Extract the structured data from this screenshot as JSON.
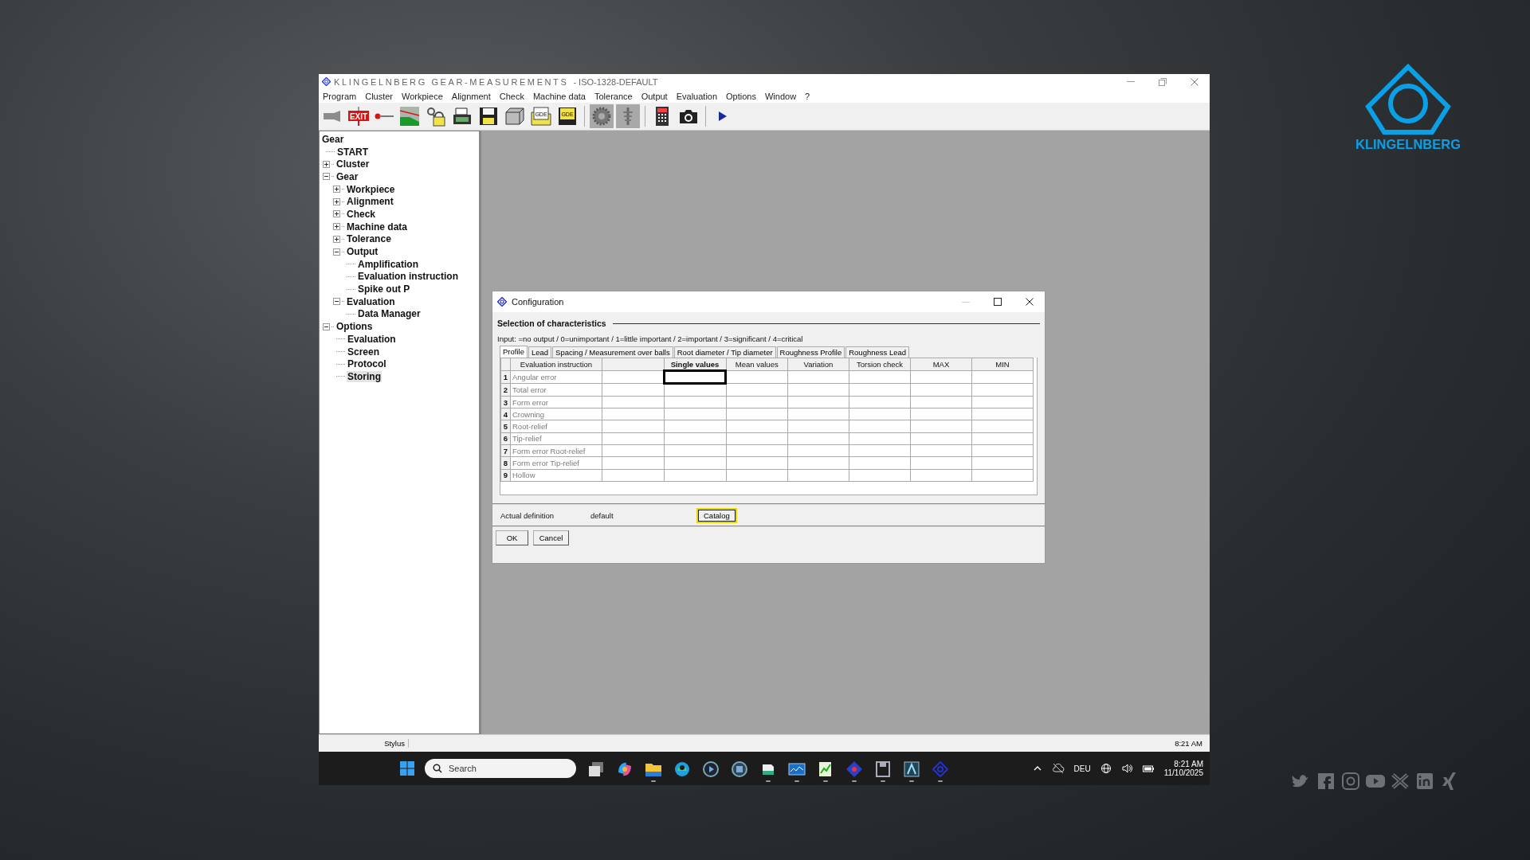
{
  "brand": {
    "logo_text": "KLINGELNBERG"
  },
  "social": [
    {
      "kind": "bird"
    },
    {
      "kind": "facebook"
    },
    {
      "kind": "instagram"
    },
    {
      "kind": "youtube"
    },
    {
      "kind": "cross"
    },
    {
      "kind": "linkedin"
    },
    {
      "kind": "xing"
    }
  ],
  "window": {
    "title_brand": "KLINGELNBERG GEAR-MEASUREMENTS",
    "title_suffix": "- ISO-1328-DEFAULT"
  },
  "menu": [
    "Program",
    "Cluster",
    "Workpiece",
    "Alignment",
    "Check",
    "Machine data",
    "Tolerance",
    "Output",
    "Evaluation",
    "Options",
    "Window",
    "?"
  ],
  "toolbar": [
    [
      {
        "kind": "probe",
        "pressed": false
      },
      {
        "kind": "exit",
        "label": "EXIT",
        "pressed": false
      },
      {
        "kind": "stylus",
        "pressed": false
      },
      {
        "kind": "chart",
        "pressed": false
      },
      {
        "kind": "lock",
        "pressed": false
      },
      {
        "kind": "printer",
        "pressed": false
      },
      {
        "kind": "floppy",
        "pressed": false
      },
      {
        "kind": "drive",
        "pressed": false
      },
      {
        "kind": "gde-folder",
        "label": "GDE",
        "pressed": false
      },
      {
        "kind": "gde-floppy",
        "label": "GDE",
        "pressed": false
      }
    ],
    [
      {
        "kind": "gear",
        "pressed": true
      },
      {
        "kind": "spindle",
        "pressed": true
      }
    ],
    [
      {
        "kind": "calculator",
        "pressed": false
      },
      {
        "kind": "camera",
        "pressed": false
      }
    ],
    [
      {
        "kind": "play",
        "pressed": false
      }
    ]
  ],
  "tree": [
    {
      "label": "Gear",
      "kind": "root",
      "selected": false,
      "children": [
        {
          "label": "START",
          "kind": "leaf",
          "selected": false
        },
        {
          "label": "Cluster",
          "kind": "folder",
          "expanded": false,
          "selected": false
        },
        {
          "label": "Gear",
          "kind": "folder",
          "expanded": true,
          "selected": false,
          "children": [
            {
              "label": "Workpiece",
              "kind": "folder",
              "expanded": false,
              "selected": false
            },
            {
              "label": "Alignment",
              "kind": "folder",
              "expanded": false,
              "selected": false
            },
            {
              "label": "Check",
              "kind": "folder",
              "expanded": false,
              "selected": false
            },
            {
              "label": "Machine data",
              "kind": "folder",
              "expanded": false,
              "selected": false
            },
            {
              "label": "Tolerance",
              "kind": "folder",
              "expanded": false,
              "selected": false
            },
            {
              "label": "Output",
              "kind": "folder",
              "expanded": true,
              "selected": false,
              "children": [
                {
                  "label": "Amplification",
                  "kind": "leaf",
                  "selected": false
                },
                {
                  "label": "Evaluation instruction",
                  "kind": "leaf",
                  "selected": false
                },
                {
                  "label": "Spike out P",
                  "kind": "leaf",
                  "selected": false
                }
              ]
            },
            {
              "label": "Evaluation",
              "kind": "folder",
              "expanded": true,
              "selected": false,
              "children": [
                {
                  "label": "Data Manager",
                  "kind": "leaf",
                  "selected": false
                }
              ]
            }
          ]
        },
        {
          "label": "Options",
          "kind": "folder",
          "expanded": true,
          "selected": false,
          "children": [
            {
              "label": "Evaluation",
              "kind": "leaf",
              "selected": false
            },
            {
              "label": "Screen",
              "kind": "leaf",
              "selected": false
            },
            {
              "label": "Protocol",
              "kind": "leaf",
              "selected": false
            },
            {
              "label": "Storing",
              "kind": "leaf",
              "selected": true
            }
          ]
        }
      ]
    }
  ],
  "dialog": {
    "title": "Configuration",
    "section": "Selection of characteristics",
    "hint": "Input: =no output / 0=unimportant / 1=little important / 2=important / 3=significant / 4=critical",
    "tabs": [
      {
        "label": "Profile",
        "selected": true
      },
      {
        "label": "Lead",
        "selected": false
      },
      {
        "label": "Spacing / Measurement over balls",
        "selected": false
      },
      {
        "label": "Root diameter / Tip diameter",
        "selected": false
      },
      {
        "label": "Roughness Profile",
        "selected": false
      },
      {
        "label": "Roughness Lead",
        "selected": false
      }
    ],
    "columns": [
      {
        "label": "Evaluation instruction",
        "selected": false
      },
      {
        "label": "Single values",
        "selected": true
      },
      {
        "label": "Mean values",
        "selected": false
      },
      {
        "label": "Variation",
        "selected": false
      },
      {
        "label": "Torsion check",
        "selected": false
      },
      {
        "label": "MAX",
        "selected": false
      },
      {
        "label": "MIN",
        "selected": false
      }
    ],
    "rows": [
      {
        "number": "1",
        "name": "Angular error",
        "focused": true
      },
      {
        "number": "2",
        "name": "Total error",
        "focused": false
      },
      {
        "number": "3",
        "name": "Form error",
        "focused": false
      },
      {
        "number": "4",
        "name": "Crowning",
        "focused": false
      },
      {
        "number": "5",
        "name": "Root-relief",
        "focused": false
      },
      {
        "number": "6",
        "name": "Tip-relief",
        "focused": false
      },
      {
        "number": "7",
        "name": "Form error Root-relief",
        "focused": false
      },
      {
        "number": "8",
        "name": "Form error Tip-relief",
        "focused": false
      },
      {
        "number": "9",
        "name": "Hollow",
        "focused": false
      }
    ],
    "definition_label": "Actual definition",
    "definition_value": "default",
    "catalog_button": {
      "label": "Catalog",
      "focused": true
    },
    "buttons": [
      "OK",
      "Cancel"
    ]
  },
  "status_bar": {
    "panel": "Stylus",
    "time": "8:21 AM"
  },
  "taskbar": {
    "search_placeholder": "Search",
    "apps": [
      {
        "kind": "task-view",
        "running": false
      },
      {
        "kind": "copilot",
        "running": false
      },
      {
        "kind": "explorer",
        "running": true
      },
      {
        "kind": "edge",
        "running": false
      },
      {
        "kind": "media",
        "running": false
      },
      {
        "kind": "settings",
        "running": false
      },
      {
        "kind": "files",
        "running": true
      },
      {
        "kind": "monitor",
        "running": true
      },
      {
        "kind": "notepad",
        "running": true
      },
      {
        "kind": "diamond",
        "running": true
      },
      {
        "kind": "floppy",
        "running": true
      },
      {
        "kind": "letter",
        "running": true
      },
      {
        "kind": "eye",
        "running": true
      }
    ],
    "language": "DEU",
    "time": "8:21 AM",
    "date": "11/10/2025"
  }
}
